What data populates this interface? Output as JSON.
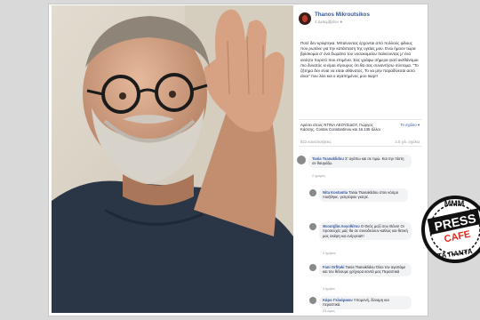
{
  "post": {
    "author": "Thanos Mikroutsikos",
    "date": "4 Δεκεμβρίου",
    "globe": "●",
    "body": "Ποτέ δεν κρύφτηκα. Μπαίνοντας έρχονται από πολλούς φίλους που ρωτάνε για την κατάσταση της υγείας μου. Ενώ ήμουν τώρα βρίσκομαι σ' ένα δωμάτιο του νοσοκομείου παλεύοντας μ' ένα ανόητο πυρετό που επιμένει. Σας γράφω σήμερα γιατί αισθάνομαι πιο δυνατός κι είμαι σίγουρος ότι θα σας συναντήσω σύντομα. \"Το ζήτημα δεν είναι να είσαι αθάνατος. Το να μην παραδίνεσαι αυτό είναι\" που λέει και ο αγαπημένος μου Ικαρ!!",
    "article_title": "Αρέσει στους ΝΤΙΝΑ ΛΕΟΥΣΙΔΟΥ, Γιώργος Κάσσης, Costas Constantinou και 16.135 άλλοι",
    "article_link": "Το σχόλιο ▾",
    "stats_left": "822 κοινοποιήσεις",
    "stats_right": "3.5 χιλ. σχόλια"
  },
  "comments": [
    {
      "name": "Tania Tsanaklidou",
      "text": "Σ' αγάπω και σε τιμώ. Και την πίστη σε θαυμάζω.",
      "meta": "2 ημέρες"
    },
    {
      "name": "Nita Kostantia",
      "text": "Tania Tsanaklidou στον κόσμο ποιήθηκε, γιατρέψου γιατρέ.",
      "meta": ""
    },
    {
      "name": "Θεοσηβία Λογοθέτου",
      "text": "Ο Θεός μαζί σου Θάνο! Οι προσευχές μας θα σε συνοδεύουν καθώς και θετική μας σκέψη και ενέργεια!!!",
      "meta": "2 ημέρες"
    },
    {
      "name": "Fani Orfitaki",
      "text": "Tania Tsanaklidou Όλοι τον αγαπάμε και τον θέλουμε γρήγορα κοντά μας Περαστικά",
      "meta": "1 ημέρα"
    },
    {
      "name": "Κάρο Γκλιάρικου",
      "text": "Υπομονή, δύναμη και περαστικά.",
      "meta": "23 ώρες"
    }
  ],
  "logo": {
    "line_top": "MMM",
    "line_main": "PRESS",
    "line_sub": "CAFE",
    "line_bottom": "ΤΑ ΠΑΝΤΑ"
  }
}
